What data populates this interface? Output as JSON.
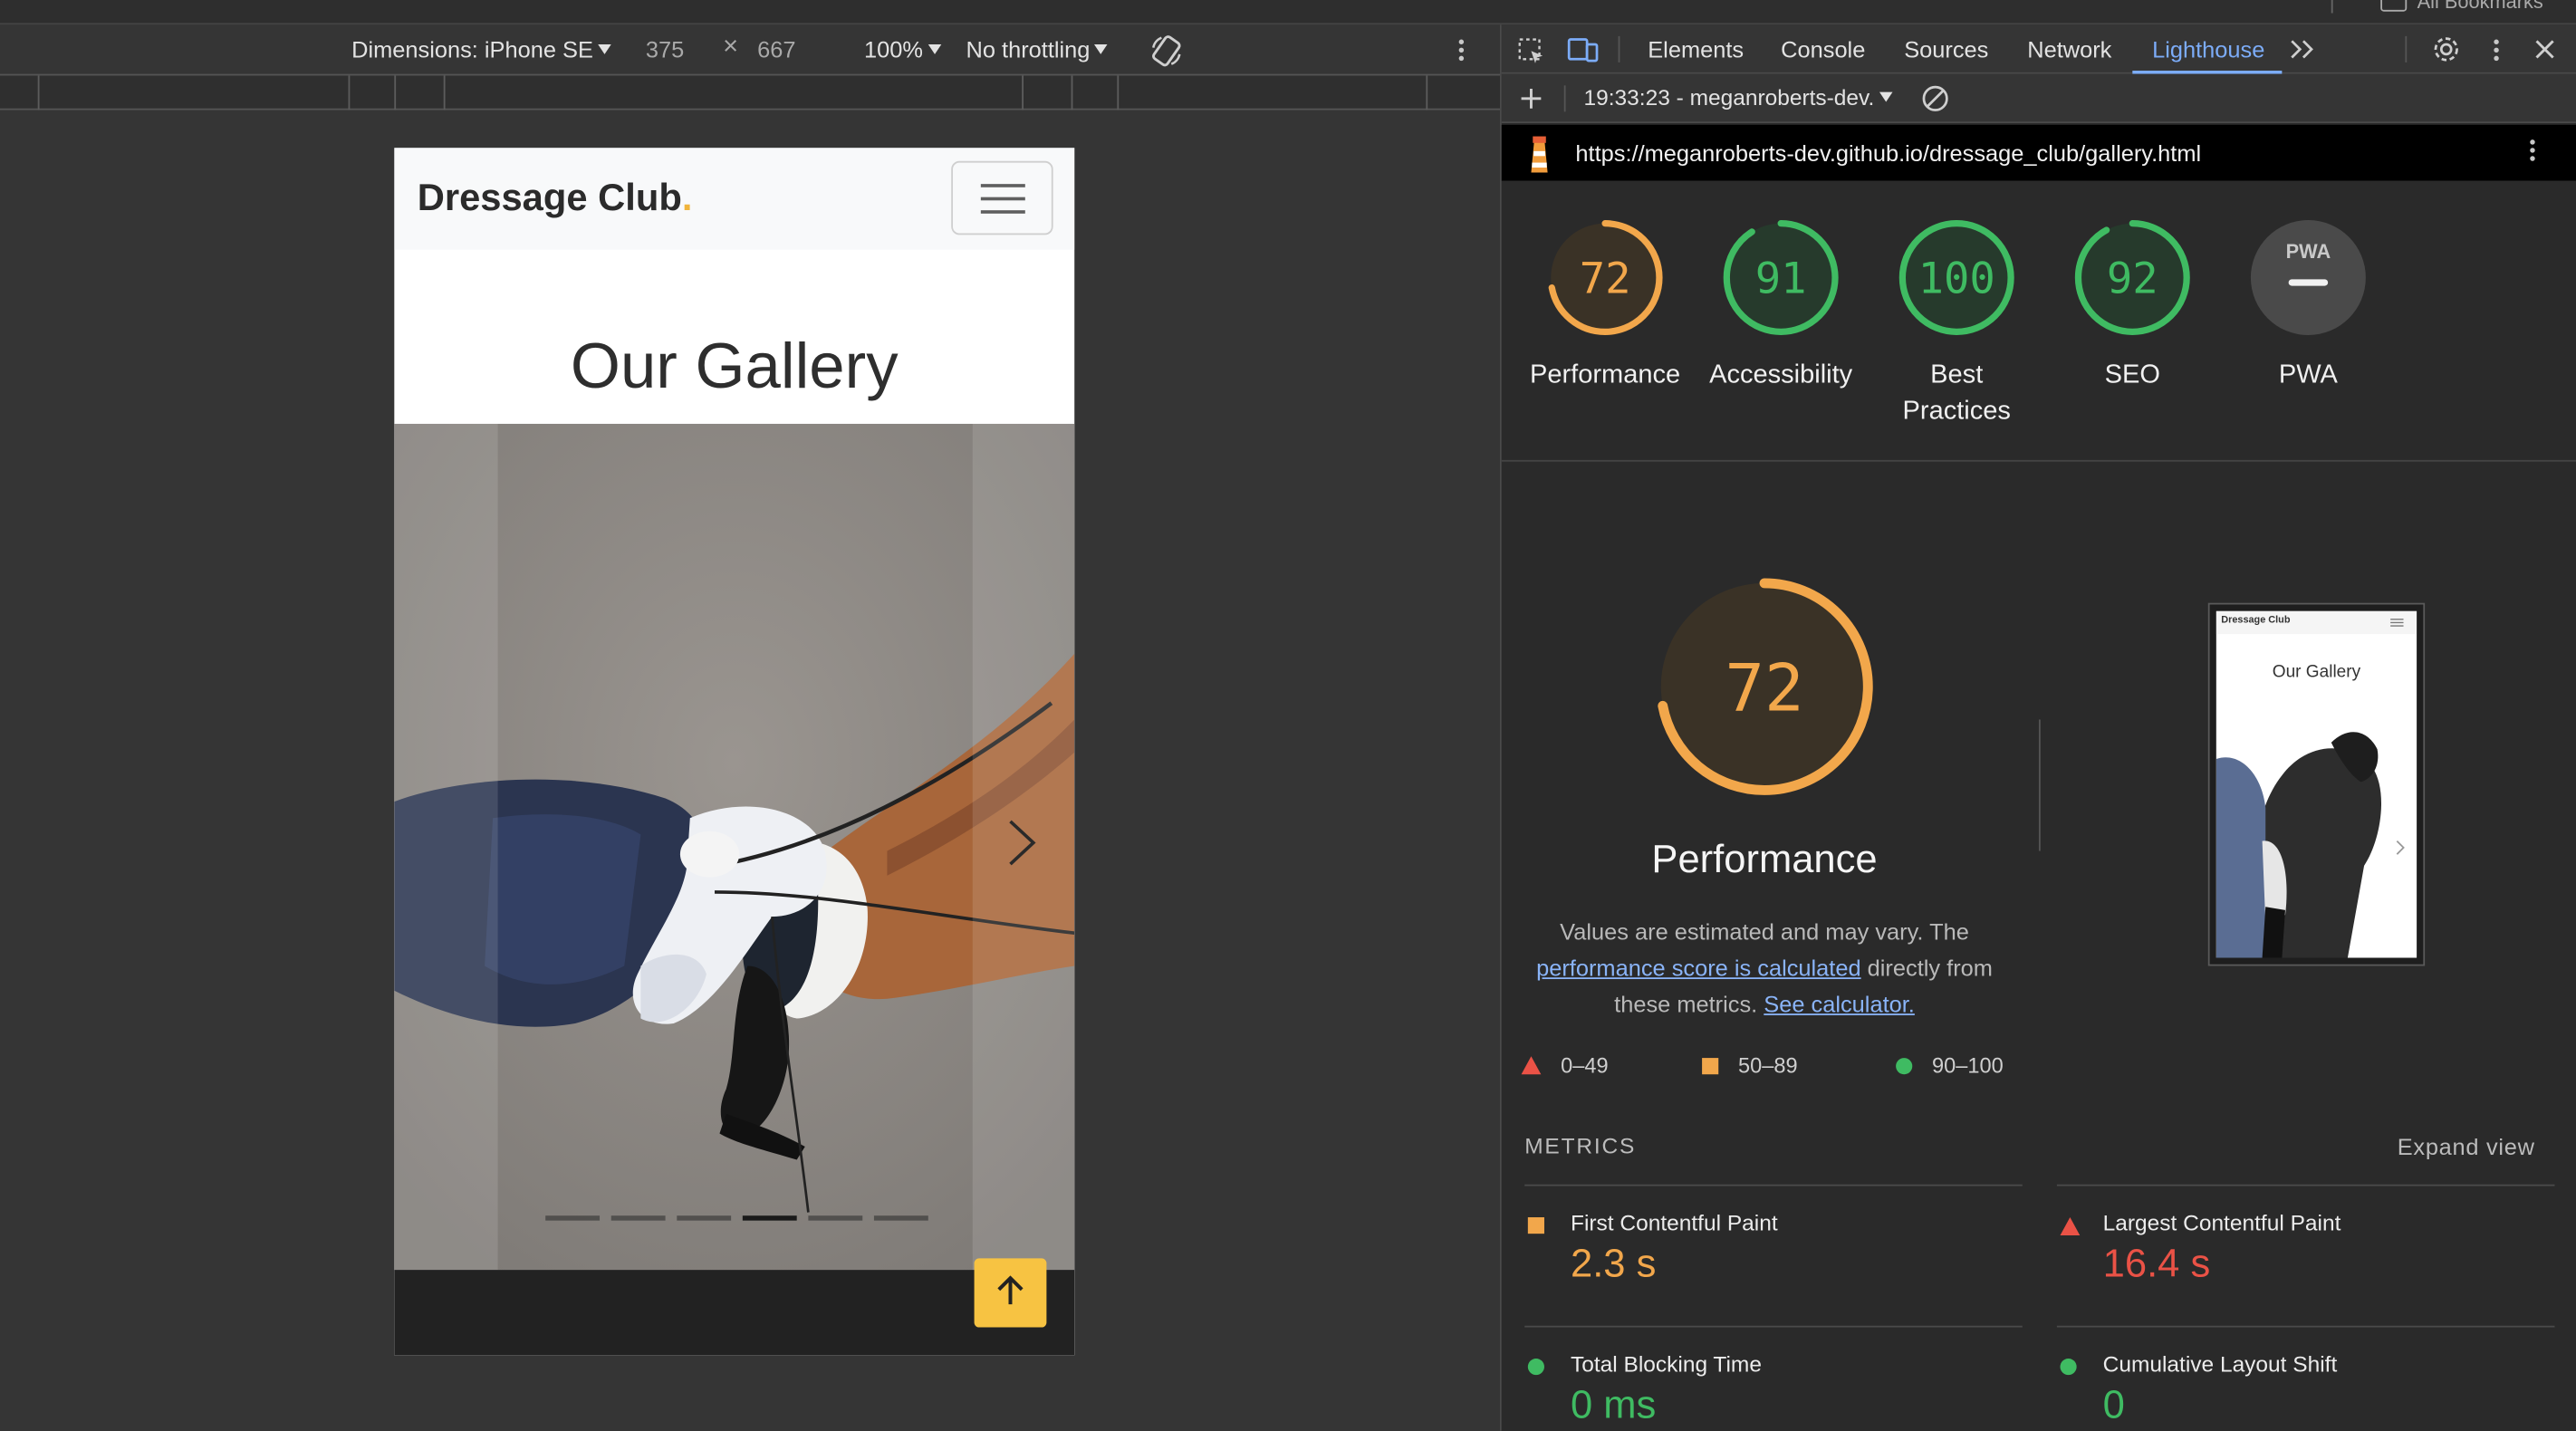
{
  "device_toolbar": {
    "dimensions_label": "Dimensions: iPhone SE",
    "width": "375",
    "times": "×",
    "height": "667",
    "zoom": "100%",
    "throttle": "No throttling"
  },
  "devtools": {
    "tabs": [
      "Elements",
      "Console",
      "Sources",
      "Network",
      "Lighthouse"
    ],
    "active_tab": "Lighthouse",
    "report_label": "19:33:23 - meganroberts-dev.",
    "url": "https://meganroberts-dev.github.io/dressage_club/gallery.html"
  },
  "scores": [
    {
      "value": "72",
      "label": "Performance",
      "score": 72,
      "color": "#f2a74b"
    },
    {
      "value": "91",
      "label": "Accessibility",
      "score": 91,
      "color": "#3fbb62"
    },
    {
      "value": "100",
      "label": "Best Practices",
      "score": 100,
      "color": "#3fbb62"
    },
    {
      "value": "92",
      "label": "SEO",
      "score": 92,
      "color": "#3fbb62"
    },
    {
      "value": "PWA",
      "label": "PWA",
      "score": null,
      "color": "#9e9e9e"
    }
  ],
  "performance": {
    "score": "72",
    "score_num": 72,
    "title": "Performance",
    "desc_1": "Values are estimated and may vary. The",
    "desc_link": "performance score is calculated",
    "desc_2": "directly from",
    "desc_3": "these metrics.",
    "desc_link2": "See calculator."
  },
  "legend": {
    "fail": "0–49",
    "average": "50–89",
    "pass": "90–100"
  },
  "metrics": {
    "heading": "METRICS",
    "expand": "Expand view",
    "items": [
      {
        "name": "First Contentful Paint",
        "value": "2.3 s",
        "status": "average",
        "color": "#f2a74b"
      },
      {
        "name": "Largest Contentful Paint",
        "value": "16.4 s",
        "status": "fail",
        "color": "#ea5246"
      },
      {
        "name": "Total Blocking Time",
        "value": "0 ms",
        "status": "pass",
        "color": "#3fbb62"
      },
      {
        "name": "Cumulative Layout Shift",
        "value": "0",
        "status": "pass",
        "color": "#3fbb62"
      }
    ]
  },
  "site": {
    "brand": "Dressage Club",
    "brand_dot": ".",
    "page_title": "Our Gallery",
    "carousel_slides": 6,
    "carousel_active": 4
  },
  "thumbnail": {
    "brand": "Dressage Club",
    "title": "Our Gallery"
  },
  "bookmarks_label": "All Bookmarks"
}
